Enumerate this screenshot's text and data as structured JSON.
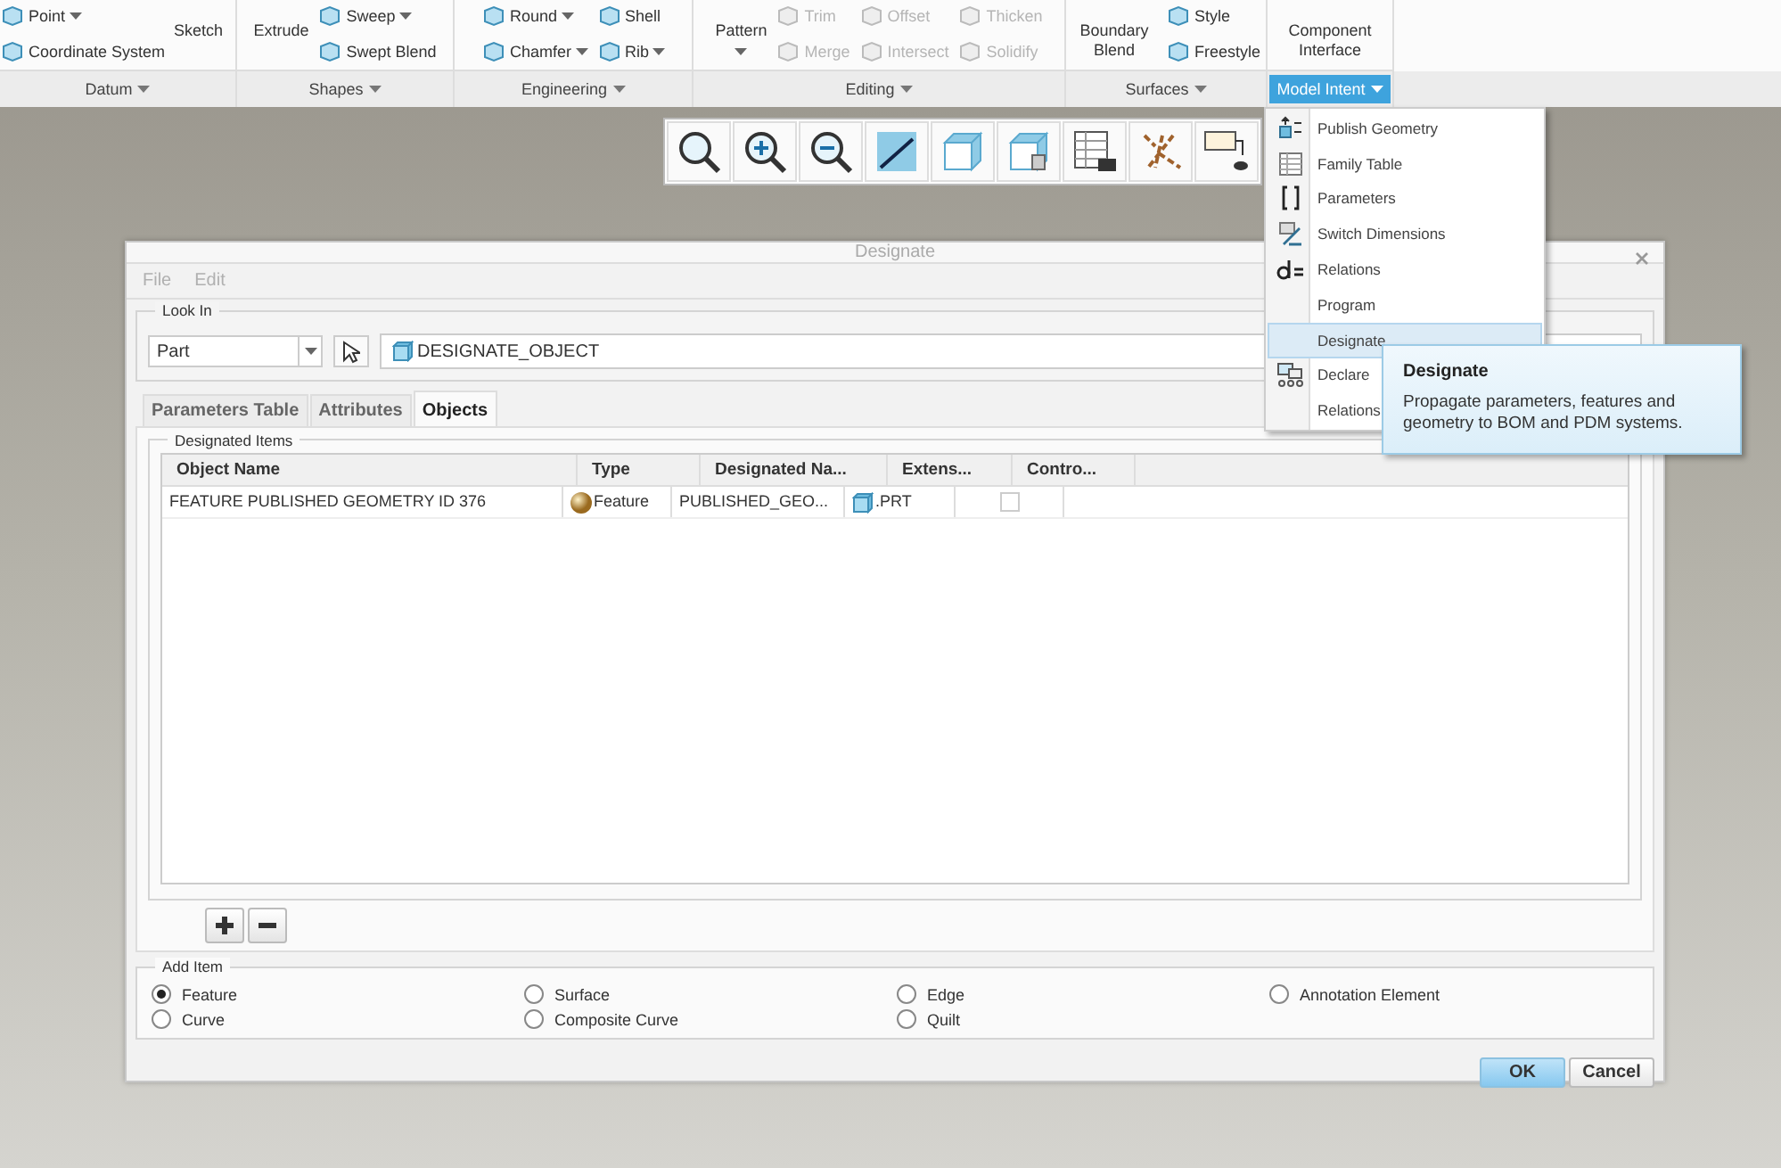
{
  "ribbon": {
    "groups": [
      {
        "label": "Datum",
        "selected": false,
        "columns": [
          {
            "kind": "small",
            "items": [
              {
                "label": "Point",
                "caret": true,
                "disabled": false
              },
              {
                "label": "Coordinate System",
                "caret": false,
                "disabled": false
              }
            ]
          },
          {
            "kind": "large",
            "label": "Sketch",
            "caret": false
          }
        ]
      },
      {
        "label": "Shapes",
        "selected": false,
        "columns": [
          {
            "kind": "large",
            "label": "Extrude",
            "caret": false
          },
          {
            "kind": "small",
            "items": [
              {
                "label": "Sweep",
                "caret": true,
                "disabled": false
              },
              {
                "label": "Swept Blend",
                "caret": false,
                "disabled": false
              }
            ]
          }
        ]
      },
      {
        "label": "Engineering",
        "selected": false,
        "columns": [
          {
            "kind": "small",
            "items": [
              {
                "label": "Round",
                "caret": true,
                "disabled": false
              },
              {
                "label": "Chamfer",
                "caret": true,
                "disabled": false
              }
            ]
          },
          {
            "kind": "small",
            "items": [
              {
                "label": "Shell",
                "caret": false,
                "disabled": false
              },
              {
                "label": "Rib",
                "caret": true,
                "disabled": false
              }
            ]
          }
        ]
      },
      {
        "label": "Editing",
        "selected": false,
        "columns": [
          {
            "kind": "large",
            "label": "Pattern",
            "caret": true
          },
          {
            "kind": "small",
            "items": [
              {
                "label": "Trim",
                "caret": false,
                "disabled": true
              },
              {
                "label": "Merge",
                "caret": false,
                "disabled": true
              }
            ]
          },
          {
            "kind": "small",
            "items": [
              {
                "label": "Offset",
                "caret": false,
                "disabled": true
              },
              {
                "label": "Intersect",
                "caret": false,
                "disabled": true
              }
            ]
          },
          {
            "kind": "small",
            "items": [
              {
                "label": "Thicken",
                "caret": false,
                "disabled": true
              },
              {
                "label": "Solidify",
                "caret": false,
                "disabled": true
              }
            ]
          }
        ]
      },
      {
        "label": "Surfaces",
        "selected": false,
        "columns": [
          {
            "kind": "large",
            "label": "Boundary Blend",
            "caret": false
          },
          {
            "kind": "small",
            "items": [
              {
                "label": "Style",
                "caret": false,
                "disabled": false
              },
              {
                "label": "Freestyle",
                "caret": false,
                "disabled": false
              }
            ]
          }
        ]
      },
      {
        "label": "Model Intent",
        "selected": true,
        "columns": [
          {
            "kind": "large",
            "label": "Component Interface",
            "caret": false
          }
        ]
      }
    ]
  },
  "menu": {
    "items": [
      {
        "label": "Publish Geometry",
        "selected": false
      },
      {
        "label": "Family Table",
        "selected": false
      },
      {
        "label": "Parameters",
        "selected": false
      },
      {
        "label": "Switch Dimensions",
        "selected": false
      },
      {
        "label": "Relations",
        "selected": false
      },
      {
        "label": "Program",
        "selected": false
      },
      {
        "label": "Designate",
        "selected": true
      },
      {
        "label": "Declare",
        "selected": false
      },
      {
        "label": "Relations",
        "selected": false
      }
    ]
  },
  "tooltip": {
    "title": "Designate",
    "text": "Propagate parameters, features and geometry to BOM and PDM systems."
  },
  "dialog": {
    "title": "Designate",
    "menubar": [
      {
        "label": "File",
        "disabled": true
      },
      {
        "label": "Edit",
        "disabled": true
      }
    ],
    "look_in": {
      "legend": "Look In",
      "select": "Part",
      "object": "DESIGNATE_OBJECT"
    },
    "tabs": [
      {
        "label": "Parameters Table",
        "selected": false
      },
      {
        "label": "Attributes",
        "selected": false
      },
      {
        "label": "Objects",
        "selected": true
      }
    ],
    "designated_items": {
      "legend": "Designated Items",
      "columns": [
        "Object Name",
        "Type",
        "Designated Na...",
        "Extens...",
        "Contro..."
      ],
      "rows": [
        {
          "object_name": "FEATURE PUBLISHED GEOMETRY ID 376",
          "type": "Feature",
          "designated_name": "PUBLISHED_GEO...",
          "extension": ".PRT",
          "control_checked": false
        }
      ]
    },
    "add_item": {
      "legend": "Add Item",
      "options": [
        {
          "label": "Feature",
          "selected": true
        },
        {
          "label": "Surface",
          "selected": false
        },
        {
          "label": "Edge",
          "selected": false
        },
        {
          "label": "Annotation Element",
          "selected": false
        },
        {
          "label": "Curve",
          "selected": false
        },
        {
          "label": "Composite Curve",
          "selected": false
        },
        {
          "label": "Quilt",
          "selected": false
        }
      ]
    },
    "buttons": [
      {
        "label": "OK",
        "primary": true
      },
      {
        "label": "Cancel",
        "primary": false
      }
    ]
  }
}
